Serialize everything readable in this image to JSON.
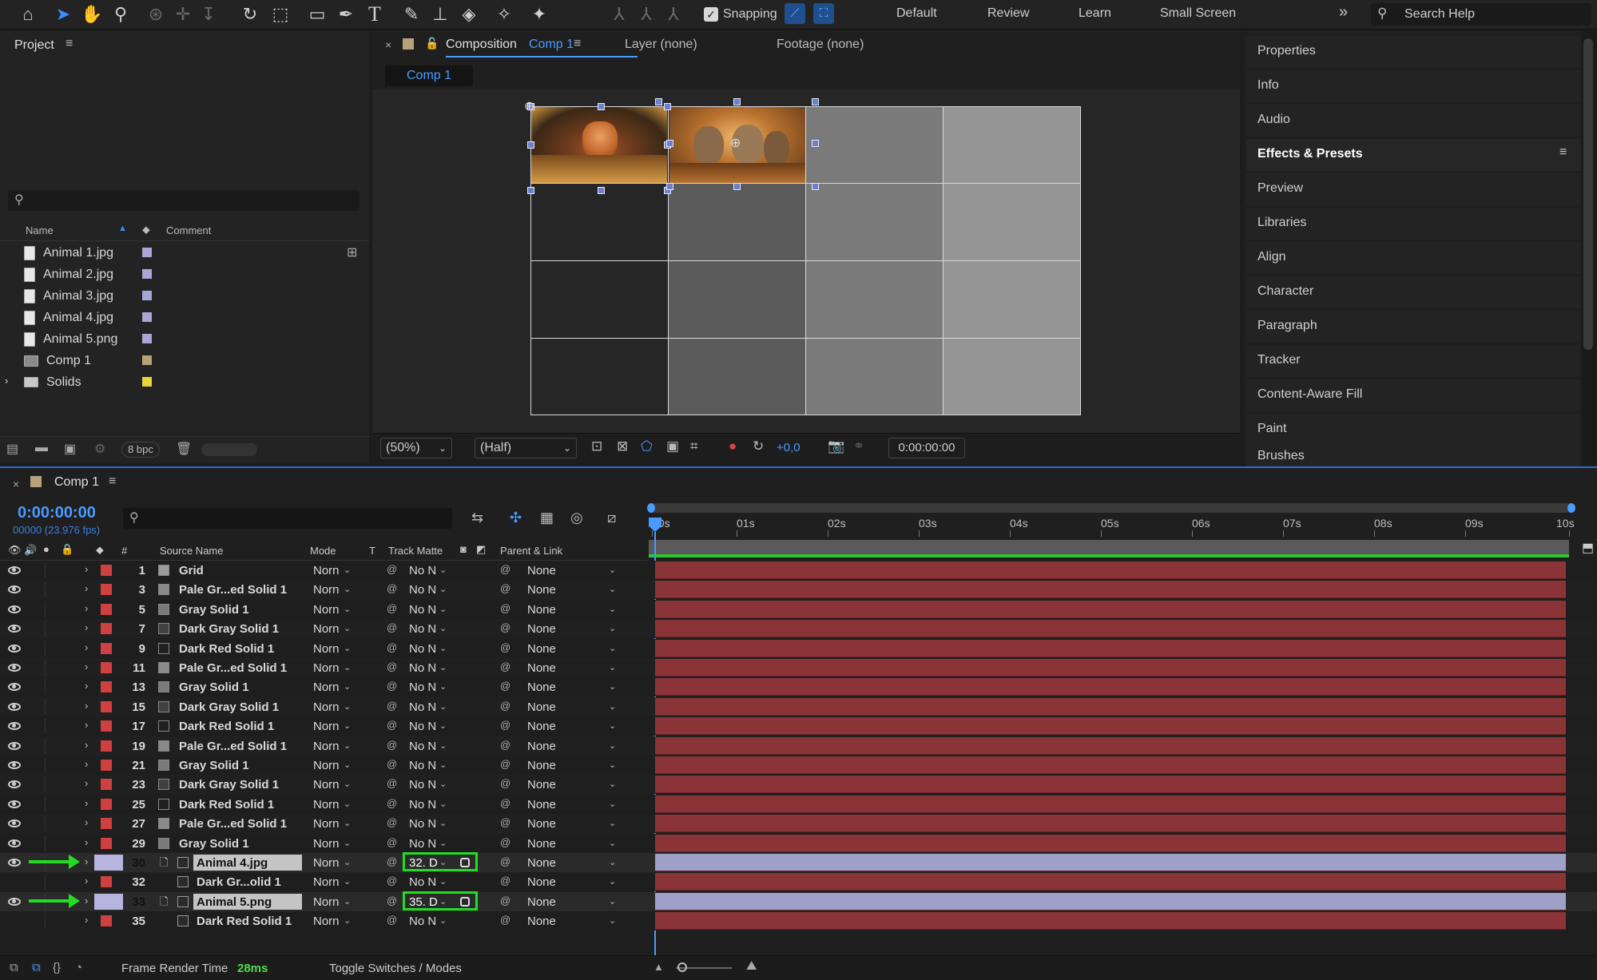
{
  "toolbar": {
    "snapping_label": "Snapping",
    "workspaces": [
      "Default",
      "Review",
      "Learn",
      "Small Screen"
    ],
    "search_placeholder": "Search Help"
  },
  "project": {
    "title": "Project",
    "col_name": "Name",
    "col_comment": "Comment",
    "items": [
      {
        "name": "Animal 1.jpg",
        "color": "#a9a6d6"
      },
      {
        "name": "Animal 2.jpg",
        "color": "#a9a6d6"
      },
      {
        "name": "Animal 3.jpg",
        "color": "#a9a6d6"
      },
      {
        "name": "Animal 4.jpg",
        "color": "#a9a6d6"
      },
      {
        "name": "Animal 5.png",
        "color": "#a9a6d6"
      },
      {
        "name": "Comp 1",
        "color": "#b8a27a"
      },
      {
        "name": "Solids",
        "color": "#e9d43a"
      }
    ],
    "bpc": "8 bpc"
  },
  "composition": {
    "tab_prefix": "Composition",
    "tab_name": "Comp 1",
    "layer_tab": "Layer (none)",
    "footage_tab": "Footage (none)",
    "sub_tab": "Comp 1",
    "zoom": "(50%)",
    "resolution": "(Half)",
    "exposure": "+0,0",
    "timecode": "0:00:00:00"
  },
  "right_panel": {
    "items": [
      "Properties",
      "Info",
      "Audio",
      "Effects & Presets",
      "Preview",
      "Libraries",
      "Align",
      "Character",
      "Paragraph",
      "Tracker",
      "Content-Aware Fill",
      "Paint",
      "Brushes"
    ]
  },
  "timeline": {
    "tab": "Comp 1",
    "timecode": "0:00:00:00",
    "fps": "00000 (23.976 fps)",
    "headers": {
      "num": "#",
      "source": "Source Name",
      "mode": "Mode",
      "t": "T",
      "track_matte": "Track Matte",
      "parent": "Parent & Link"
    },
    "ruler": [
      "00s",
      "01s",
      "02s",
      "03s",
      "04s",
      "05s",
      "06s",
      "07s",
      "08s",
      "09s",
      "10s"
    ],
    "layers": [
      {
        "num": "1",
        "name": "Grid",
        "mode": "Norn",
        "matte": "No N",
        "parent": "None",
        "label": "#d04040",
        "icon": "#9a9a9a",
        "eye": true,
        "type": "solid"
      },
      {
        "num": "3",
        "name": "Pale Gr...ed Solid 1",
        "mode": "Norn",
        "matte": "No N",
        "parent": "None",
        "label": "#d04040",
        "icon": "#8a8a8a",
        "eye": true,
        "type": "solid"
      },
      {
        "num": "5",
        "name": "Gray Solid 1",
        "mode": "Norn",
        "matte": "No N",
        "parent": "None",
        "label": "#d04040",
        "icon": "#7a7a7a",
        "eye": true,
        "type": "solid"
      },
      {
        "num": "7",
        "name": "Dark Gray Solid 1",
        "mode": "Norn",
        "matte": "No N",
        "parent": "None",
        "label": "#d04040",
        "icon": "#404040",
        "eye": true,
        "type": "solid"
      },
      {
        "num": "9",
        "name": "Dark Red Solid 1",
        "mode": "Norn",
        "matte": "No N",
        "parent": "None",
        "label": "#d04040",
        "icon": "#202020",
        "eye": true,
        "type": "solid"
      },
      {
        "num": "11",
        "name": "Pale Gr...ed Solid 1",
        "mode": "Norn",
        "matte": "No N",
        "parent": "None",
        "label": "#d04040",
        "icon": "#8a8a8a",
        "eye": true,
        "type": "solid"
      },
      {
        "num": "13",
        "name": "Gray Solid 1",
        "mode": "Norn",
        "matte": "No N",
        "parent": "None",
        "label": "#d04040",
        "icon": "#7a7a7a",
        "eye": true,
        "type": "solid"
      },
      {
        "num": "15",
        "name": "Dark Gray Solid 1",
        "mode": "Norn",
        "matte": "No N",
        "parent": "None",
        "label": "#d04040",
        "icon": "#404040",
        "eye": true,
        "type": "solid"
      },
      {
        "num": "17",
        "name": "Dark Red Solid 1",
        "mode": "Norn",
        "matte": "No N",
        "parent": "None",
        "label": "#d04040",
        "icon": "#202020",
        "eye": true,
        "type": "solid"
      },
      {
        "num": "19",
        "name": "Pale Gr...ed Solid 1",
        "mode": "Norn",
        "matte": "No N",
        "parent": "None",
        "label": "#d04040",
        "icon": "#8a8a8a",
        "eye": true,
        "type": "solid"
      },
      {
        "num": "21",
        "name": "Gray Solid 1",
        "mode": "Norn",
        "matte": "No N",
        "parent": "None",
        "label": "#d04040",
        "icon": "#7a7a7a",
        "eye": true,
        "type": "solid"
      },
      {
        "num": "23",
        "name": "Dark Gray Solid 1",
        "mode": "Norn",
        "matte": "No N",
        "parent": "None",
        "label": "#d04040",
        "icon": "#404040",
        "eye": true,
        "type": "solid"
      },
      {
        "num": "25",
        "name": "Dark Red Solid 1",
        "mode": "Norn",
        "matte": "No N",
        "parent": "None",
        "label": "#d04040",
        "icon": "#202020",
        "eye": true,
        "type": "solid"
      },
      {
        "num": "27",
        "name": "Pale Gr...ed Solid 1",
        "mode": "Norn",
        "matte": "No N",
        "parent": "None",
        "label": "#d04040",
        "icon": "#8a8a8a",
        "eye": true,
        "type": "solid"
      },
      {
        "num": "29",
        "name": "Gray Solid 1",
        "mode": "Norn",
        "matte": "No N",
        "parent": "None",
        "label": "#d04040",
        "icon": "#7a7a7a",
        "eye": true,
        "type": "solid"
      },
      {
        "num": "30",
        "name": "Animal 4.jpg",
        "mode": "Norn",
        "matte": "32. D",
        "parent": "None",
        "label": "#b7b4e0",
        "icon": "#e0e0e0",
        "eye": true,
        "type": "image"
      },
      {
        "num": "32",
        "name": "Dark Gr...olid 1",
        "mode": "Norn",
        "matte": "No N",
        "parent": "None",
        "label": "#d04040",
        "icon": "#404040",
        "eye": false,
        "type": "matte"
      },
      {
        "num": "33",
        "name": "Animal 5.png",
        "mode": "Norn",
        "matte": "35. D",
        "parent": "None",
        "label": "#b7b4e0",
        "icon": "#e0e0e0",
        "eye": true,
        "type": "image"
      },
      {
        "num": "35",
        "name": "Dark Red Solid 1",
        "mode": "Norn",
        "matte": "No N",
        "parent": "None",
        "label": "#d04040",
        "icon": "#202020",
        "eye": false,
        "type": "matte"
      }
    ],
    "footer_render_label": "Frame Render Time",
    "footer_render_value": "28ms",
    "footer_toggle": "Toggle Switches / Modes"
  }
}
